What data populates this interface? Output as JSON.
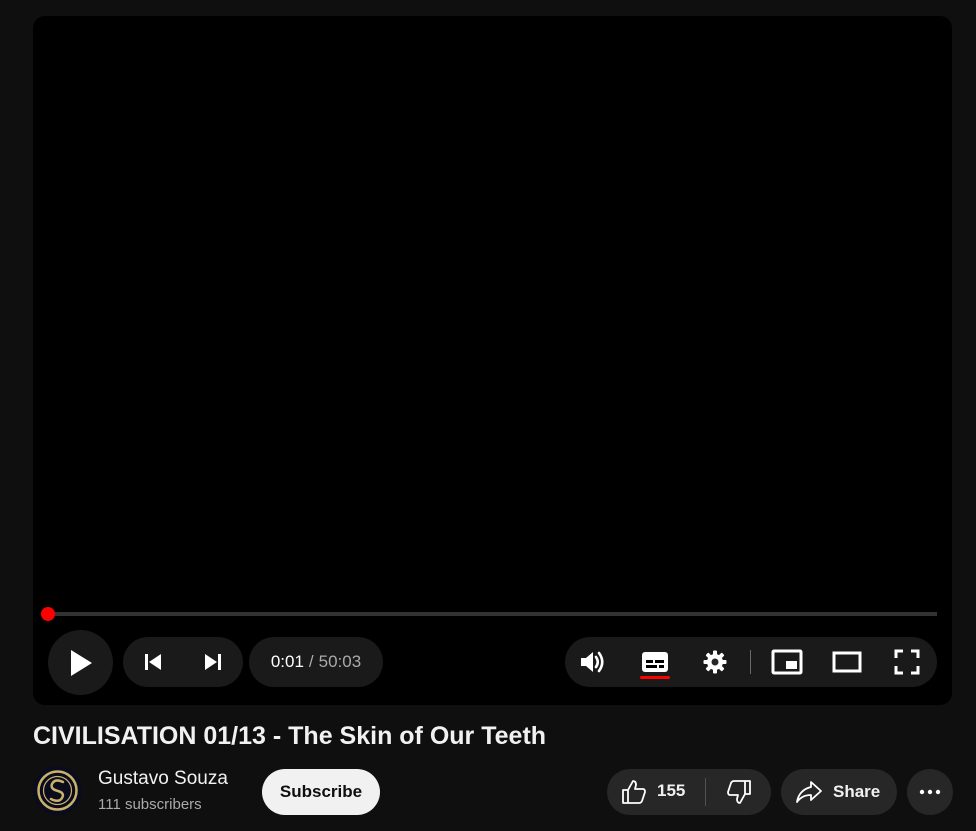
{
  "player": {
    "current_time": "0:01",
    "separator": "/",
    "duration": "50:03",
    "progress": 0.0003,
    "accent_color": "#ff0000"
  },
  "controls": {
    "icons": [
      "play-icon",
      "previous-icon",
      "next-icon",
      "volume-icon",
      "subtitles-icon",
      "settings-icon",
      "miniplayer-icon",
      "theater-mode-icon",
      "fullscreen-icon"
    ]
  },
  "video": {
    "title": "CIVILISATION 01/13 - The Skin of Our Teeth"
  },
  "channel": {
    "name": "Gustavo Souza",
    "subscribers": "111 subscribers",
    "subscribe_label": "Subscribe"
  },
  "actions": {
    "like_count": "155",
    "share_label": "Share"
  }
}
